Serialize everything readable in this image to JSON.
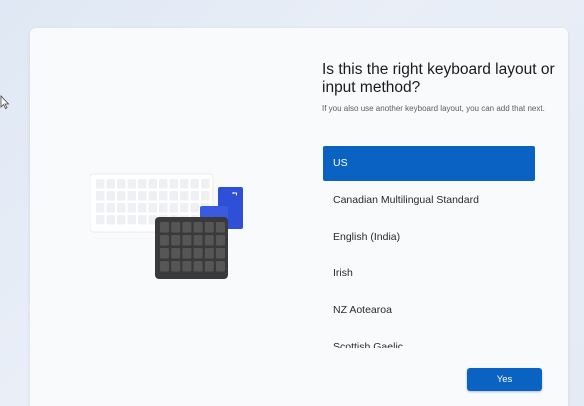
{
  "oobe": {
    "title": "Is this the right keyboard layout or input method?",
    "subtitle": "If you also use another keyboard layout, you can add that next.",
    "layouts": [
      {
        "label": "US",
        "selected": true
      },
      {
        "label": "Canadian Multilingual Standard",
        "selected": false
      },
      {
        "label": "English (India)",
        "selected": false
      },
      {
        "label": "Irish",
        "selected": false
      },
      {
        "label": "NZ Aotearoa",
        "selected": false
      },
      {
        "label": "Scottish Gaelic",
        "selected": false
      }
    ],
    "yes_label": "Yes"
  },
  "icons": {
    "cursor": "mouse-pointer-icon",
    "illustration": "keyboard-keypad-illustration",
    "key_arrow": "back-arrow-icon"
  },
  "colors": {
    "accent": "#0a62c2",
    "panel": "#f9fafc",
    "keypad": "#3a3a3a"
  }
}
